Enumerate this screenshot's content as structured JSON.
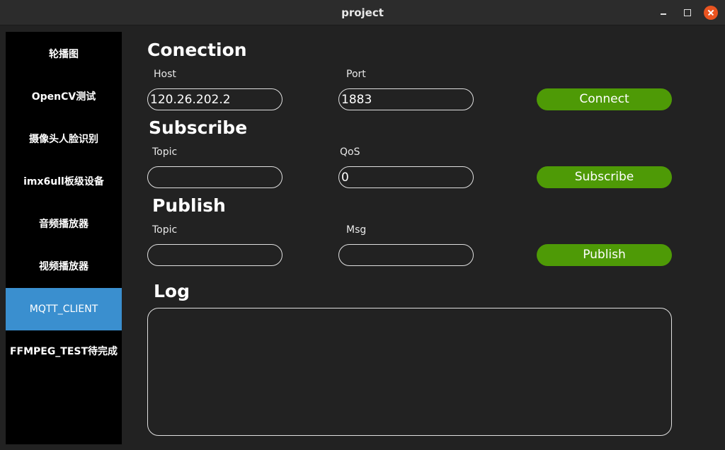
{
  "window": {
    "title": "project"
  },
  "sidebar": {
    "items": [
      {
        "label": "轮播图"
      },
      {
        "label": "OpenCV测试"
      },
      {
        "label": "摄像头人脸识别"
      },
      {
        "label": "imx6ull板级设备"
      },
      {
        "label": "音频播放器"
      },
      {
        "label": "视频播放器"
      },
      {
        "label": "MQTT_CLIENT",
        "active": true
      },
      {
        "label": "FFMPEG_TEST待完成"
      }
    ],
    "active_color": "#3a8fcf"
  },
  "connection": {
    "title": "Conection",
    "host_label": "Host",
    "host_value": "120.26.202.2",
    "port_label": "Port",
    "port_value": "1883",
    "button_label": "Connect"
  },
  "subscribe": {
    "title": "Subscribe",
    "topic_label": "Topic",
    "topic_value": "",
    "qos_label": "QoS",
    "qos_value": "0",
    "button_label": "Subscribe"
  },
  "publish": {
    "title": "Publish",
    "topic_label": "Topic",
    "topic_value": "",
    "msg_label": "Msg",
    "msg_value": "",
    "button_label": "Publish"
  },
  "log": {
    "title": "Log",
    "content": ""
  },
  "colors": {
    "button_green": "#4e9a06",
    "close_orange": "#e95420",
    "background": "#222222"
  }
}
